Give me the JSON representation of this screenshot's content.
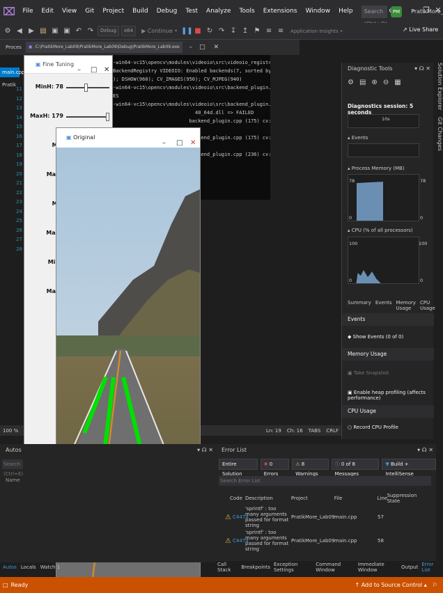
{
  "menubar": {
    "logo": "⌧",
    "items": [
      "File",
      "Edit",
      "View",
      "Git",
      "Project",
      "Build",
      "Debug",
      "Test",
      "Analyze",
      "Tools",
      "Extensions",
      "Window",
      "Help"
    ],
    "search_placeholder": "Search (Ctrl+Q)",
    "project_name": "PratikMore_Lab09",
    "avatar": "PM"
  },
  "toolbar": {
    "config": "Debug",
    "platform": "x64",
    "continue": "▶ Continue •",
    "app_insights": "Application Insights •",
    "live_share": "Live Share"
  },
  "tabs": {
    "process": "Proces",
    "path": "C:\\PratikMore_Lab09\\PratikMore_Lab09\\Debug\\PratikMore_Lab09.exe"
  },
  "editor": {
    "file_tab": "main.cpp",
    "project_label": "Pratik",
    "line_numbers": [
      "11",
      "12",
      "13",
      "14",
      "15",
      "16",
      "17",
      "18",
      "19",
      "20",
      "21",
      "22",
      "23",
      "24",
      "25",
      "26",
      "27",
      "28"
    ],
    "zoom": "100 %",
    "line": "Ln: 19",
    "col": "Ch: 16",
    "tabs": "TABS",
    "eol": "CRLF"
  },
  "console": {
    "lines": [
      "-win64-vc15\\opencv\\modules\\videoio\\src\\videoio_registry.cpp (191) cv::anon",
      "BackendRegistry VIDEOIO: Enabled backends(7, sorted by priority): FFMPEG(1",
      "); DSHOW(960); CV_IMAGES(950); CV_MJPEG(940)",
      "-win64-vc15\\opencv\\modules\\videoio\\src\\backend_plugin.cpp (370) cv::impl::",
      "ES",
      "-win64-vc15\\opencv\\modules\\videoio\\src\\backend_plugin.cpp (175) cv::impl::",
      "                            40_64d.dll => FAILED",
      "                          backend_plugin.cpp (175) cv::impl::",
      "",
      "                          backend_plugin.cpp (175) cv::impl::",
      "",
      "                          backend_plugin.cpp (236) cv::impl::"
    ]
  },
  "finetune": {
    "title": "Fine Tuning",
    "trackbars": [
      {
        "label": "MinH: 78",
        "value": 0.45
      },
      {
        "label": "MaxH: 179",
        "value": 1.0
      },
      {
        "label": "Min",
        "value": 0
      },
      {
        "label": "MaxS",
        "value": 0
      },
      {
        "label": "Min",
        "value": 0
      },
      {
        "label": "MaxV",
        "value": 0
      },
      {
        "label": "MinC",
        "value": 0
      },
      {
        "label": "MaxC",
        "value": 0
      }
    ]
  },
  "original": {
    "title": "Original"
  },
  "diagnostics": {
    "title": "Diagnostic Tools",
    "session": "Diagnostics session: 5 seconds",
    "timeline_tick": "10s",
    "events_label": "▴ Events",
    "memory_label": "▴ Process Memory (MB)",
    "memory_max": "78",
    "memory_min": "0",
    "cpu_label": "▴ CPU (% of all processors)",
    "cpu_max": "100",
    "cpu_min": "0",
    "tabs": [
      "Summary",
      "Events",
      "Memory Usage",
      "CPU Usage"
    ],
    "events_header": "Events",
    "show_events": "Show Events (0 of 0)",
    "memory_usage_header": "Memory Usage",
    "take_snapshot": "Take Snapshot",
    "heap_profiling": "Enable heap profiling (affects performance)",
    "cpu_usage_header": "CPU Usage",
    "record_cpu": "Record CPU Profile"
  },
  "side_tabs": [
    "Solution Explorer",
    "Git Changes"
  ],
  "autos": {
    "title": "Autos",
    "search": "Search (Ctrl+E)",
    "name_col": "Name",
    "tabs": [
      "Autos",
      "Locals",
      "Watch 1"
    ]
  },
  "error_list": {
    "title": "Error List",
    "scope": "Entire Solution",
    "errors": "0 Errors",
    "warnings": "8 Warnings",
    "messages": "0 of 8 Messages",
    "build": "Build + IntelliSense",
    "search": "Search Error List",
    "columns": [
      "Code",
      "Description",
      "Project",
      "File",
      "Line",
      "Suppression State"
    ],
    "rows": [
      {
        "code": "C4474",
        "description": "'sprintf' : too many arguments passed for format string",
        "project": "PratikMore_Lab09",
        "file": "main.cpp",
        "line": "57"
      },
      {
        "code": "C4474",
        "description": "'sprintf' : too many arguments passed for format string",
        "project": "PratikMore_Lab09",
        "file": "main.cpp",
        "line": "58"
      }
    ],
    "bottom_tabs": [
      "Call Stack",
      "Breakpoints",
      "Exception Settings",
      "Command Window",
      "Immediate Window",
      "Output",
      "Error List"
    ]
  },
  "statusbar": {
    "ready": "Ready",
    "source_control": "↑ Add to Source Control ▴"
  },
  "colors": {
    "accent": "#007acc",
    "status": "#ca5100",
    "lane": "#00e000"
  }
}
